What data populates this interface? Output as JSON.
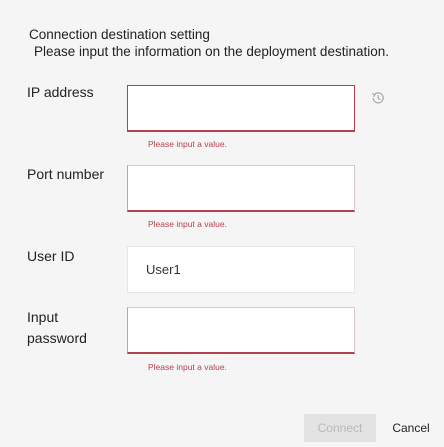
{
  "header": {
    "title": "Connection destination setting",
    "description": "Please input the information on the deployment destination."
  },
  "fields": {
    "ip": {
      "label": "IP address",
      "value": "",
      "error": "Please input a value."
    },
    "port": {
      "label": "Port number",
      "value": "",
      "error": "Please input a value."
    },
    "user": {
      "label": "User ID",
      "value": "User1"
    },
    "password": {
      "label_line1": "Input",
      "label_line2": "password",
      "value": "",
      "error": "Please input a value."
    }
  },
  "icons": {
    "history": "history-icon"
  },
  "buttons": {
    "connect": "Connect",
    "cancel": "Cancel"
  },
  "colors": {
    "error": "#b1434f",
    "disabled_bg": "#e3e3e3",
    "disabled_text": "#b8b8b8"
  }
}
